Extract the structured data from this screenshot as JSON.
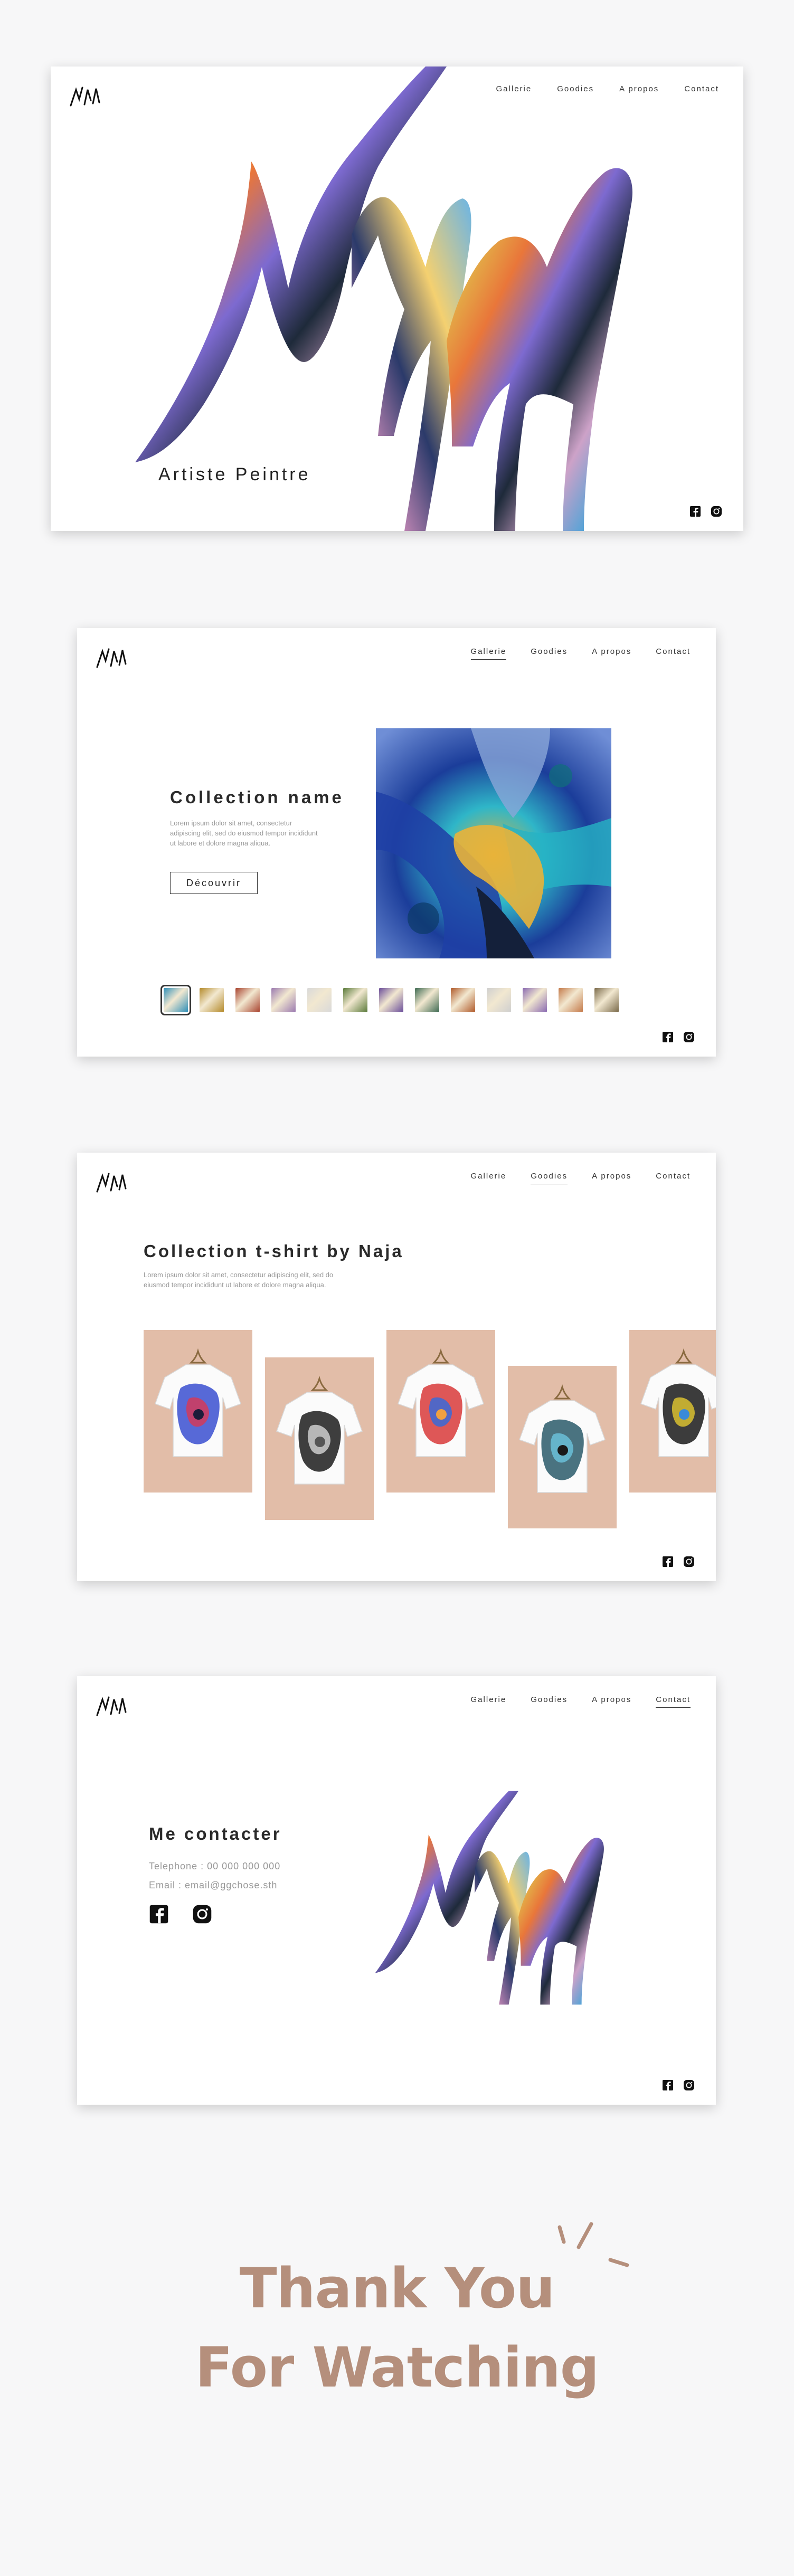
{
  "nav": {
    "gallery": "Gallerie",
    "goodies": "Goodies",
    "about": "A propos",
    "contact": "Contact"
  },
  "hero": {
    "tagline": "Artiste Peintre"
  },
  "gallery": {
    "title": "Collection name",
    "description": "Lorem ipsum dolor sit amet, consectetur adipiscing elit, sed do eiusmod tempor incididunt ut labore et dolore magna aliqua.",
    "button": "Découvrir",
    "thumbnail_colors": [
      "#2f8fb8",
      "#b48a2a",
      "#a8432f",
      "#9b7ab0",
      "#d9d9d9",
      "#5a7a3a",
      "#6a4d9a",
      "#3e6a52",
      "#b05a2a",
      "#cfcfcf",
      "#8a6ab2",
      "#c47a4a",
      "#7a6a4a"
    ]
  },
  "goodies": {
    "title": "Collection t-shirt by Naja",
    "description": "Lorem ipsum dolor sit amet, consectetur adipiscing elit, sed do eiusmod tempor incididunt ut labore et dolore magna aliqua."
  },
  "contact": {
    "title": "Me contacter",
    "phone": "Telephone : 00 000 000 000",
    "email": "Email : email@ggchose.sth"
  },
  "closing": {
    "line1": "Thank You",
    "line2": "For Watching"
  },
  "icons": [
    "facebook-icon",
    "instagram-icon",
    "naja-logo"
  ],
  "colors": {
    "accent": "#b58f7c",
    "text": "#222222",
    "muted": "#999999"
  }
}
